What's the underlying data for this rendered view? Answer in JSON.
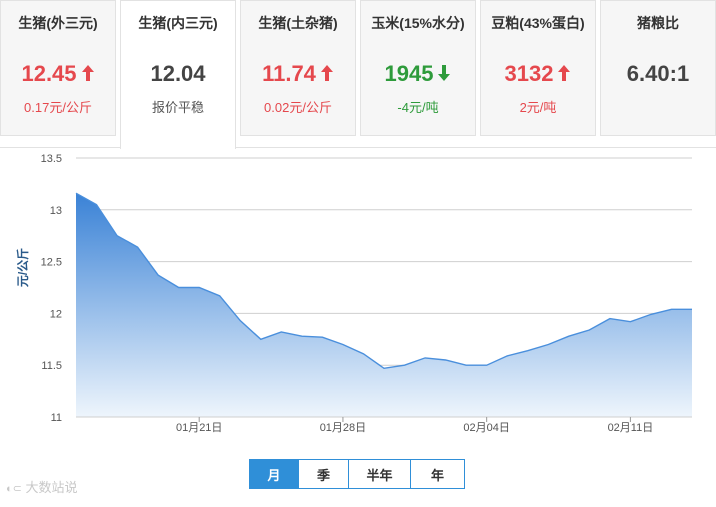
{
  "tabs": [
    {
      "name": "生猪(外三元)",
      "price": "12.45",
      "change": "0.17元/公斤",
      "dir": "up"
    },
    {
      "name": "生猪(内三元)",
      "price": "12.04",
      "change": "报价平稳",
      "dir": "flat"
    },
    {
      "name": "生猪(土杂猪)",
      "price": "11.74",
      "change": "0.02元/公斤",
      "dir": "up"
    },
    {
      "name": "玉米(15%水分)",
      "price": "1945",
      "change": "-4元/吨",
      "dir": "down"
    },
    {
      "name": "豆粕(43%蛋白)",
      "price": "3132",
      "change": "2元/吨",
      "dir": "up"
    },
    {
      "name": "猪粮比",
      "price": "6.40:1",
      "change": "",
      "dir": "none"
    }
  ],
  "period_buttons": [
    "月",
    "季",
    "半年",
    "年"
  ],
  "selected_period": "月",
  "watermark": "大数站说",
  "colors": {
    "up": "#e5484d",
    "down": "#2e9b3b",
    "accent": "#2f8fd8",
    "area_top": "#3a82d6",
    "area_bottom": "#eef5fc"
  },
  "chart_data": {
    "type": "area",
    "ylabel": "元/公斤",
    "ylim": [
      11,
      13.5
    ],
    "yticks": [
      "11",
      "11.5",
      "12",
      "12.5",
      "13",
      "13.5"
    ],
    "grid": true,
    "xtick_labels": [
      "01月21日",
      "01月28日",
      "02月04日",
      "02月11日"
    ],
    "xtick_index": [
      6,
      13,
      20,
      27
    ],
    "values": [
      13.16,
      13.05,
      12.75,
      12.64,
      12.37,
      12.25,
      12.25,
      12.17,
      11.93,
      11.75,
      11.82,
      11.78,
      11.77,
      11.7,
      11.61,
      11.47,
      11.5,
      11.57,
      11.55,
      11.5,
      11.5,
      11.59,
      11.64,
      11.7,
      11.78,
      11.84,
      11.95,
      11.92,
      11.99,
      12.04,
      12.04
    ]
  }
}
